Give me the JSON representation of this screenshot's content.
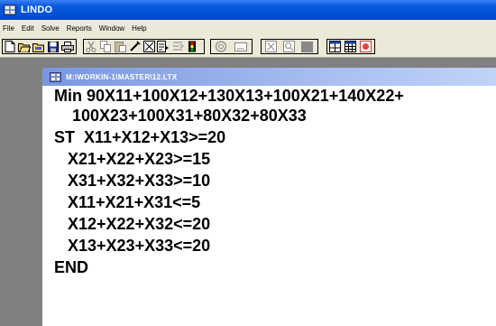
{
  "window": {
    "title": "LINDO"
  },
  "menu": {
    "items": [
      "File",
      "Edit",
      "Solve",
      "Reports",
      "Window",
      "Help"
    ]
  },
  "toolbar": {
    "group1": [
      "new-file-icon",
      "open-file-icon",
      "open-folder-icon",
      "save-icon",
      "print-icon"
    ],
    "group2": [
      "cut-icon",
      "copy-icon",
      "paste-icon",
      "find-icon",
      "replace-icon",
      "goto-icon",
      "compile-icon",
      "stop-icon"
    ],
    "group3": [
      "solve-icon",
      "picture-icon"
    ],
    "group4": [
      "close-all-icon",
      "zoom-icon",
      "fill-icon"
    ],
    "group5": [
      "tile-icon",
      "cascade-icon",
      "options-icon"
    ]
  },
  "document": {
    "title": "M:\\WORKIN-1\\MASTER\\12.LTX",
    "lines": [
      "Min 90X11+100X12+130X13+100X21+140X22+",
      "    100X23+100X31+80X32+80X33",
      "ST  X11+X12+X13>=20",
      "   X21+X22+X23>=15",
      "   X31+X32+X33>=10",
      "   X11+X21+X31<=5",
      "   X12+X22+X32<=20",
      "   X13+X23+X33<=20",
      "END"
    ]
  }
}
